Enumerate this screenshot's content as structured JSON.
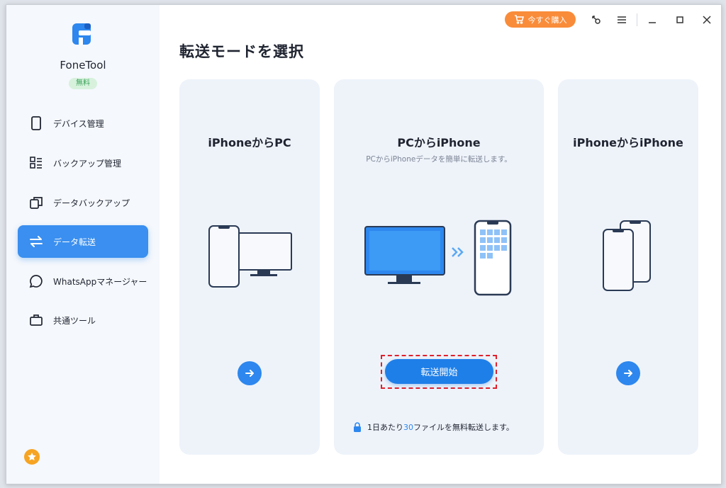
{
  "app": {
    "name": "FoneTool",
    "badge": "無料"
  },
  "sidebar": {
    "items": [
      {
        "label": "デバイス管理",
        "icon": "phone-icon"
      },
      {
        "label": "バックアップ管理",
        "icon": "backup-list-icon"
      },
      {
        "label": "データバックアップ",
        "icon": "copy-icon"
      },
      {
        "label": "データ転送",
        "icon": "transfer-icon",
        "active": true
      },
      {
        "label": "WhatsAppマネージャー",
        "icon": "chat-icon"
      },
      {
        "label": "共通ツール",
        "icon": "toolbox-icon"
      }
    ],
    "star_icon": "star-icon"
  },
  "titlebar": {
    "buy_label": "今すぐ購入",
    "icons": [
      "key-icon",
      "menu-icon",
      "minimize-icon",
      "maximize-icon",
      "close-icon"
    ]
  },
  "main": {
    "title": "転送モードを選択",
    "cards": [
      {
        "title": "iPhoneからPC",
        "subtitle": ""
      },
      {
        "title": "PCからiPhone",
        "subtitle": "PCからiPhoneデータを簡単に転送します。",
        "button": "転送開始"
      },
      {
        "title": "iPhoneからiPhone",
        "subtitle": ""
      }
    ],
    "note": {
      "prefix": "1日あたり",
      "count": "30",
      "suffix": "ファイルを無料転送します。"
    }
  },
  "colors": {
    "accent": "#2d87ee",
    "buy": "#f98c3a",
    "highlight_frame": "#e0202b",
    "free_badge": "#38a356"
  }
}
